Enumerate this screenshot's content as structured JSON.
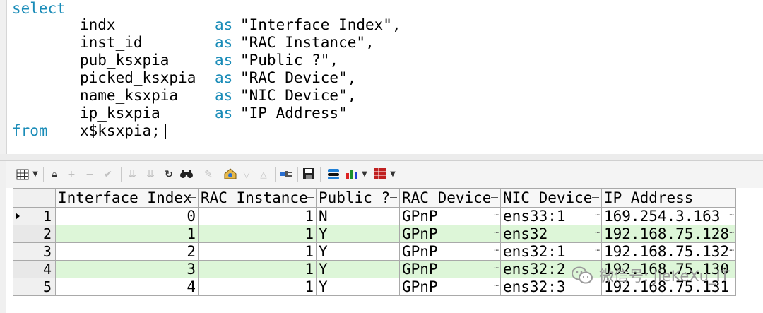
{
  "editor": {
    "lines": [
      {
        "kw": "select",
        "text": ""
      },
      {
        "kw": "",
        "text": "indx",
        "as": "as",
        "alias": "\"Interface Index\","
      },
      {
        "kw": "",
        "text": "inst_id",
        "as": "as",
        "alias": "\"RAC Instance\","
      },
      {
        "kw": "",
        "text": "pub_ksxpia",
        "as": "as",
        "alias": "\"Public ?\","
      },
      {
        "kw": "",
        "text": "picked_ksxpia",
        "as": "as",
        "alias": "\"RAC Device\","
      },
      {
        "kw": "",
        "text": "name_ksxpia",
        "as": "as",
        "alias": "\"NIC Device\","
      },
      {
        "kw": "",
        "text": "ip_ksxpia",
        "as": "as",
        "alias": "\"IP Address\""
      },
      {
        "kw": "from",
        "text": "x$ksxpia;"
      }
    ]
  },
  "grid": {
    "columns": [
      "Interface Index",
      "RAC Instance",
      "Public ?",
      "RAC Device",
      "NIC Device",
      "IP Address"
    ],
    "rows": [
      {
        "n": "1",
        "cells": [
          "0",
          "1",
          "N",
          "GPnP",
          "ens33:1",
          "169.254.3.163"
        ]
      },
      {
        "n": "2",
        "cells": [
          "1",
          "1",
          "Y",
          "GPnP",
          "ens32",
          "192.168.75.128"
        ]
      },
      {
        "n": "3",
        "cells": [
          "2",
          "1",
          "Y",
          "GPnP",
          "ens32:1",
          "192.168.75.132"
        ]
      },
      {
        "n": "4",
        "cells": [
          "3",
          "1",
          "Y",
          "GPnP",
          "ens32:2",
          "192.168.75.130"
        ]
      },
      {
        "n": "5",
        "cells": [
          "4",
          "1",
          "Y",
          "GPnP",
          "ens32:3",
          "192.168.75.131"
        ]
      }
    ]
  },
  "watermark": {
    "text": "微信号: JieKeXu_IT"
  },
  "colors": {
    "keyword": "#1a8cb8",
    "alt_row": "#ddf6d8"
  }
}
